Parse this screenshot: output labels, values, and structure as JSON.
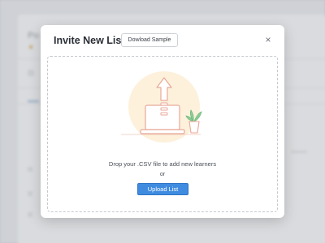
{
  "background": {
    "page_title_fragment": "Po"
  },
  "modal": {
    "title": "Invite New List",
    "sample_button_label": "Dowload Sample",
    "close_glyph": "×",
    "icons": {
      "close": "close-icon",
      "illustration": "laptop-upload-illustration"
    },
    "dropzone": {
      "instruction": "Drop your .CSV file to add new learners",
      "or_label": "or",
      "upload_button_label": "Upload List"
    }
  },
  "colors": {
    "accent": "#3f8be0",
    "illustration_circle": "#fdf1dc",
    "illustration_stroke": "#e8a998",
    "plant": "#6cb87a"
  }
}
